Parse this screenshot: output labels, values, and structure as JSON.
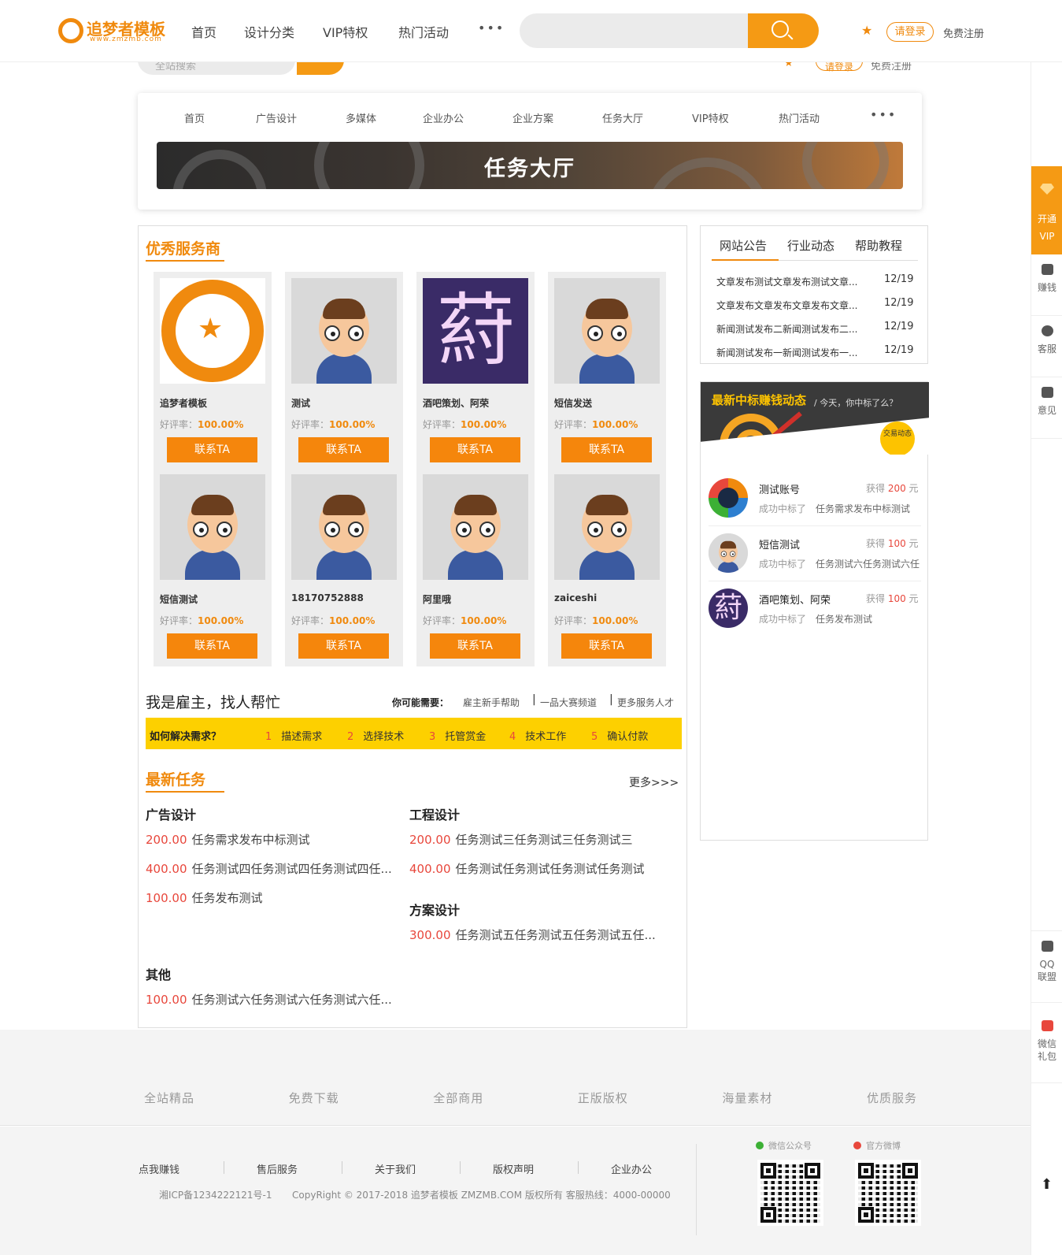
{
  "header": {
    "logo_text": "追梦者模板",
    "logo_sub": "www.zmzmb.com",
    "nav": [
      "首页",
      "设计分类",
      "VIP特权",
      "热门活动"
    ],
    "more_dots": "•••",
    "login": "请登录",
    "register": "免费注册",
    "ghost_search_placeholder": "全站搜索",
    "ghost_login": "请登录",
    "ghost_register": "免费注册"
  },
  "subnav": {
    "items": [
      "首页",
      "广告设计",
      "多媒体",
      "企业办公",
      "企业方案",
      "任务大厅",
      "VIP特权",
      "热门活动"
    ],
    "more_dots": "•••",
    "banner_title": "任务大厅"
  },
  "providers": {
    "title": "优秀服务商",
    "rating_label": "好评率：",
    "contact_label": "联系TA",
    "char_glyph": "葤",
    "items": [
      {
        "name": "追梦者模板",
        "rating": "100.00%",
        "avatar": "logo"
      },
      {
        "name": "测试",
        "rating": "100.00%",
        "avatar": "cartoon"
      },
      {
        "name": "酒吧策划、阿荣",
        "rating": "100.00%",
        "avatar": "char"
      },
      {
        "name": "短信发送",
        "rating": "100.00%",
        "avatar": "cartoon"
      },
      {
        "name": "短信测试",
        "rating": "100.00%",
        "avatar": "cartoon"
      },
      {
        "name": "18170752888",
        "rating": "100.00%",
        "avatar": "cartoon"
      },
      {
        "name": "阿里哦",
        "rating": "100.00%",
        "avatar": "cartoon"
      },
      {
        "name": "zaiceshi",
        "rating": "100.00%",
        "avatar": "cartoon"
      }
    ]
  },
  "employer": {
    "title": "我是雇主，找人帮忙",
    "need_label": "你可能需要：",
    "links": [
      "雇主新手帮助",
      "一品大赛频道",
      "更多服务人才"
    ],
    "link_sep": "|",
    "how_label": "如何解决需求？",
    "steps": [
      {
        "n": "1",
        "label": "描述需求"
      },
      {
        "n": "2",
        "label": "选择技术"
      },
      {
        "n": "3",
        "label": "托管赏金"
      },
      {
        "n": "4",
        "label": "技术工作"
      },
      {
        "n": "5",
        "label": "确认付款"
      }
    ]
  },
  "tasks": {
    "title": "最新任务",
    "more": "更多>>>",
    "categories": [
      {
        "name": "广告设计",
        "items": [
          {
            "price": "200.00",
            "title": "任务需求发布中标测试"
          },
          {
            "price": "400.00",
            "title": "任务测试四任务测试四任务测试四任..."
          },
          {
            "price": "100.00",
            "title": "任务发布测试"
          }
        ]
      },
      {
        "name": "工程设计",
        "items": [
          {
            "price": "200.00",
            "title": "任务测试三任务测试三任务测试三"
          },
          {
            "price": "400.00",
            "title": "任务测试任务测试任务测试任务测试"
          }
        ]
      },
      {
        "name": "方案设计",
        "items": [
          {
            "price": "300.00",
            "title": "任务测试五任务测试五任务测试五任..."
          }
        ]
      },
      {
        "name": "其他",
        "items": [
          {
            "price": "100.00",
            "title": "任务测试六任务测试六任务测试六任..."
          }
        ]
      }
    ]
  },
  "notice": {
    "tabs": [
      "网站公告",
      "行业动态",
      "帮助教程"
    ],
    "items": [
      {
        "title": "文章发布测试文章发布测试文章...",
        "date": "12/19"
      },
      {
        "title": "文章发布文章发布文章发布文章...",
        "date": "12/19"
      },
      {
        "title": "新闻测试发布二新闻测试发布二...",
        "date": "12/19"
      },
      {
        "title": "新闻测试发布一新闻测试发布一...",
        "date": "12/19"
      }
    ]
  },
  "winners": {
    "title": "最新中标赚钱动态",
    "subtitle": "/ 今天，你中标了么？",
    "badge": "交易动态",
    "get_label": "获得",
    "unit": "元",
    "success_label": "成功中标了",
    "items": [
      {
        "name": "测试账号",
        "amount": "200",
        "task": "任务需求发布中标测试",
        "avatar": "ring"
      },
      {
        "name": "短信测试",
        "amount": "100",
        "task": "任务测试六任务测试六任",
        "avatar": "cartoon"
      },
      {
        "name": "酒吧策划、阿荣",
        "amount": "100",
        "task": "任务发布测试",
        "avatar": "char"
      }
    ]
  },
  "sidebar": {
    "vip": "开通VIP",
    "items": [
      "赚钱",
      "客服",
      "意见"
    ],
    "bottom_items": [
      "QQ联盟",
      "微信礼包"
    ],
    "to_top": "⬆"
  },
  "footer": {
    "features": [
      "全站精品",
      "免费下载",
      "全部商用",
      "正版版权",
      "海量素材",
      "优质服务"
    ],
    "links": [
      "点我赚钱",
      "售后服务",
      "关于我们",
      "版权声明",
      "企业办公"
    ],
    "icp": "湘ICP备1234222121号-1",
    "copyright": "CopyRight © 2017-2018 追梦者模板 ZMZMB.COM 版权所有 客服热线：4000-00000",
    "wechat": "微信公众号",
    "weibo": "官方微博"
  },
  "colors": {
    "accent": "#f08a0e",
    "accent2": "#f5860c",
    "yellow": "#fdd000",
    "price": "#e8473c"
  }
}
